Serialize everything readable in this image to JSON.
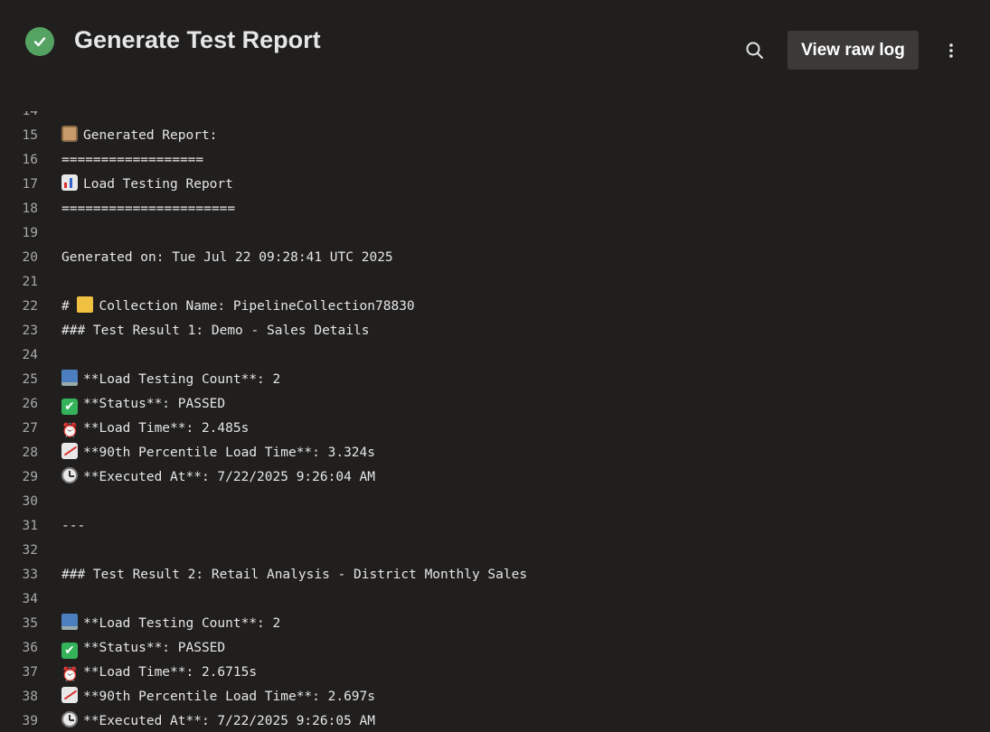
{
  "header": {
    "title": "Generate Test Report",
    "raw_log_label": "View raw log",
    "status_color": "#55a362",
    "status_icon": "check-circle-icon"
  },
  "log": {
    "lines": [
      {
        "n": "14",
        "text": "",
        "icon": ""
      },
      {
        "n": "15",
        "text": "Generated Report:",
        "icon": "clipboard"
      },
      {
        "n": "16",
        "text": "==================",
        "icon": ""
      },
      {
        "n": "17",
        "text": "Load Testing Report",
        "icon": "chart"
      },
      {
        "n": "18",
        "text": "======================",
        "icon": ""
      },
      {
        "n": "19",
        "text": "",
        "icon": ""
      },
      {
        "n": "20",
        "text": "Generated on: Tue Jul 22 09:28:41 UTC 2025",
        "icon": ""
      },
      {
        "n": "21",
        "text": "",
        "icon": ""
      },
      {
        "n": "22",
        "text": "# ",
        "icon": "folder",
        "after": "Collection Name: PipelineCollection78830"
      },
      {
        "n": "23",
        "text": "### Test Result 1: Demo - Sales Details",
        "icon": ""
      },
      {
        "n": "24",
        "text": "",
        "icon": ""
      },
      {
        "n": "25",
        "text": "**Load Testing Count**: 2",
        "icon": "laptop"
      },
      {
        "n": "26",
        "text": "**Status**: PASSED",
        "icon": "check"
      },
      {
        "n": "27",
        "text": "**Load Time**: 2.485s",
        "icon": "alarm"
      },
      {
        "n": "28",
        "text": "**90th Percentile Load Time**: 3.324s",
        "icon": "trend"
      },
      {
        "n": "29",
        "text": "**Executed At**: 7/22/2025 9:26:04 AM",
        "icon": "clock"
      },
      {
        "n": "30",
        "text": "",
        "icon": ""
      },
      {
        "n": "31",
        "text": "---",
        "icon": ""
      },
      {
        "n": "32",
        "text": "",
        "icon": ""
      },
      {
        "n": "33",
        "text": "### Test Result 2: Retail Analysis - District Monthly Sales",
        "icon": ""
      },
      {
        "n": "34",
        "text": "",
        "icon": ""
      },
      {
        "n": "35",
        "text": "**Load Testing Count**: 2",
        "icon": "laptop"
      },
      {
        "n": "36",
        "text": "**Status**: PASSED",
        "icon": "check"
      },
      {
        "n": "37",
        "text": "**Load Time**: 2.6715s",
        "icon": "alarm"
      },
      {
        "n": "38",
        "text": "**90th Percentile Load Time**: 2.697s",
        "icon": "trend"
      },
      {
        "n": "39",
        "text": "**Executed At**: 7/22/2025 9:26:05 AM",
        "icon": "clock"
      }
    ]
  }
}
